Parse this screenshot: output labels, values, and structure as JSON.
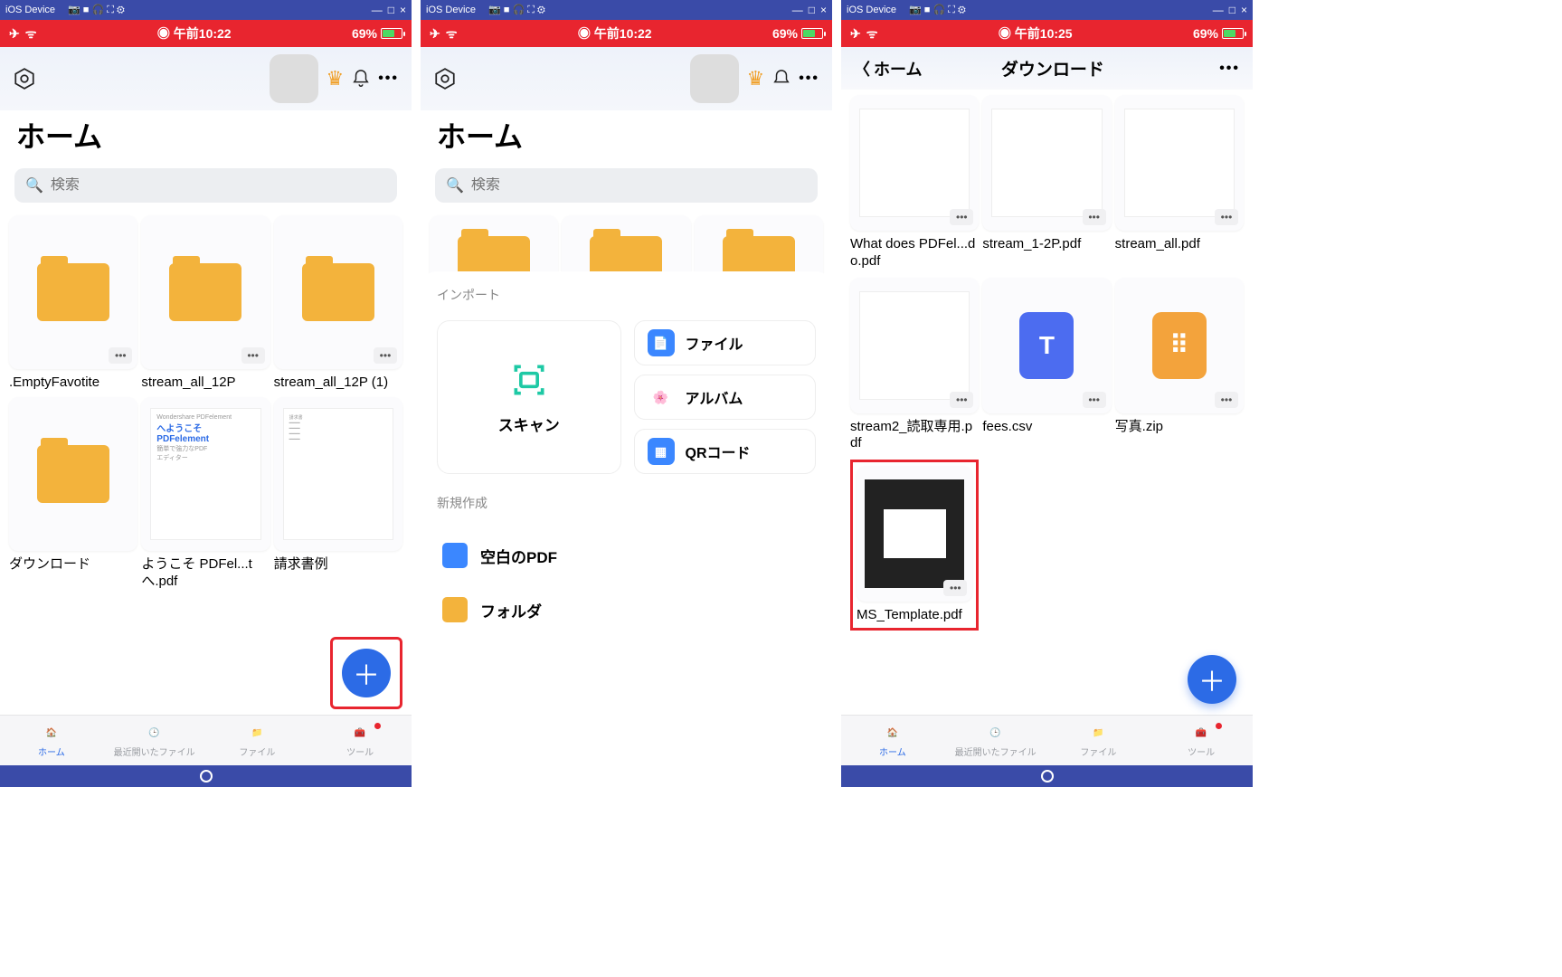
{
  "titlebar": {
    "label": "iOS Device",
    "win": [
      "—",
      "□",
      "×"
    ]
  },
  "status": {
    "time1": "午前10:22",
    "time2": "午前10:25",
    "battery": "69%"
  },
  "screen1": {
    "title": "ホーム",
    "searchPlaceholder": "検索",
    "items": [
      {
        "name": ".EmptyFavotite",
        "type": "folder"
      },
      {
        "name": "stream_all_12P",
        "type": "folder"
      },
      {
        "name": "stream_all_12P (1)",
        "type": "folder"
      },
      {
        "name": "ダウンロード",
        "type": "folder"
      },
      {
        "name": "ようこそ PDFel...t へ.pdf",
        "type": "pdf-welcome"
      },
      {
        "name": "請求書例",
        "type": "pdf-invoice"
      }
    ],
    "tabs": [
      "ホーム",
      "最近開いたファイル",
      "ファイル",
      "ツール"
    ]
  },
  "screen2": {
    "title": "ホーム",
    "searchPlaceholder": "検索",
    "import": {
      "heading": "インポート",
      "scan": "スキャン",
      "file": "ファイル",
      "album": "アルバム",
      "qr": "QRコード"
    },
    "create": {
      "heading": "新規作成",
      "blankPdf": "空白のPDF",
      "folder": "フォルダ"
    }
  },
  "screen3": {
    "back": "ホーム",
    "title": "ダウンロード",
    "items": [
      {
        "name": "What does PDFel...do.pdf",
        "type": "doc"
      },
      {
        "name": "stream_1-2P.pdf",
        "type": "doc"
      },
      {
        "name": "stream_all.pdf",
        "type": "doc"
      },
      {
        "name": "stream2_読取専用.pdf",
        "type": "doc"
      },
      {
        "name": "fees.csv",
        "type": "csv"
      },
      {
        "name": "写真.zip",
        "type": "zip"
      },
      {
        "name": "MS_Template.pdf",
        "type": "slide"
      }
    ],
    "tabs": [
      "ホーム",
      "最近開いたファイル",
      "ファイル",
      "ツール"
    ]
  }
}
